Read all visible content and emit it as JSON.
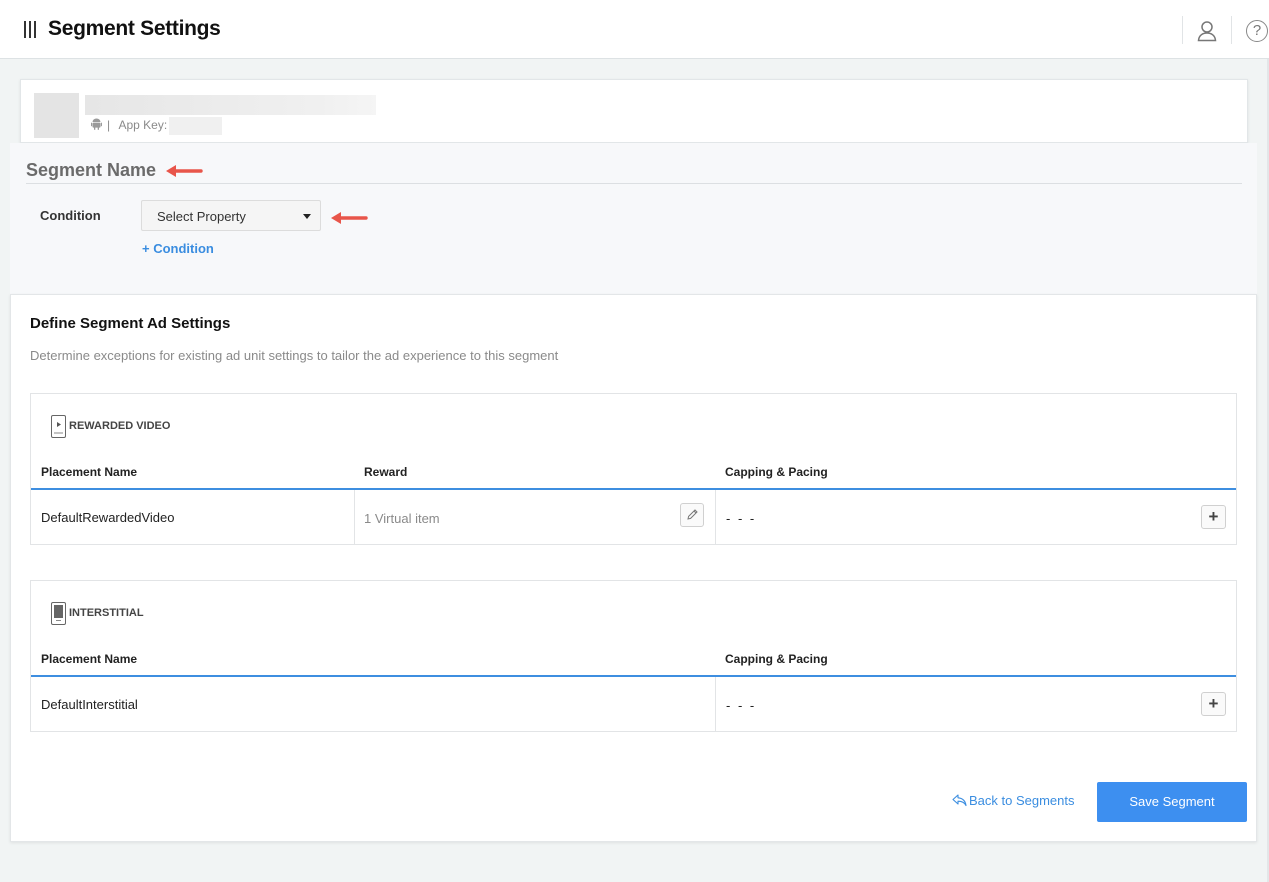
{
  "header": {
    "title": "Segment Settings",
    "icons": [
      "menu-icon",
      "user-icon",
      "help-icon"
    ],
    "help_glyph": "?"
  },
  "app_card": {
    "platform_icon": "android-icon",
    "separator": "|",
    "app_key_label": "App Key:"
  },
  "segment": {
    "name_heading": "Segment Name",
    "condition_label": "Condition",
    "select_property": "Select Property",
    "add_condition": "+ Condition"
  },
  "ad_settings": {
    "title": "Define Segment Ad Settings",
    "description": "Determine exceptions for existing ad unit settings to tailor the ad experience to this segment",
    "rewarded_video": {
      "title": "REWARDED VIDEO",
      "columns": [
        "Placement Name",
        "Reward",
        "Capping & Pacing"
      ],
      "rows": [
        {
          "placement": "DefaultRewardedVideo",
          "reward": "1 Virtual item",
          "capping": "- - -"
        }
      ]
    },
    "interstitial": {
      "title": "INTERSTITIAL",
      "columns": [
        "Placement Name",
        "Capping & Pacing"
      ],
      "rows": [
        {
          "placement": "DefaultInterstitial",
          "capping": "- - -"
        }
      ]
    }
  },
  "actions": {
    "back": "Back to Segments",
    "save": "Save Segment",
    "plus_glyph": "+"
  },
  "colors": {
    "accent": "#3d8ff0",
    "link": "#3a8de0",
    "annotation_arrow": "#e8554a"
  }
}
